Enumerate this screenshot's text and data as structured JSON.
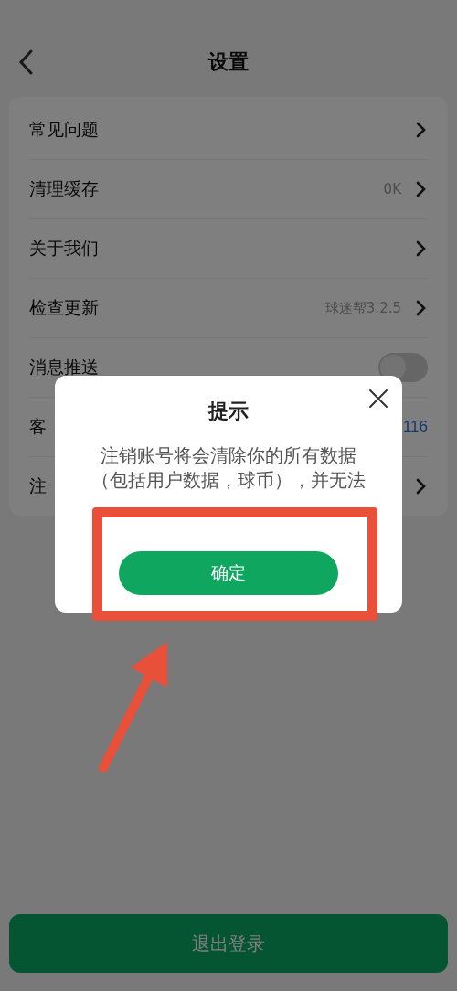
{
  "header": {
    "title": "设置"
  },
  "settings": [
    {
      "kind": "link",
      "label": "常见问题"
    },
    {
      "kind": "link",
      "label": "清理缓存",
      "value": "0K"
    },
    {
      "kind": "link",
      "label": "关于我们"
    },
    {
      "kind": "link",
      "label": "检查更新",
      "value": "球迷帮3.2.5"
    },
    {
      "kind": "toggle",
      "label": "消息推送",
      "on": false
    },
    {
      "kind": "text",
      "label": "客",
      "value": "116"
    },
    {
      "kind": "link",
      "label": "注"
    }
  ],
  "logout_button": "退出登录",
  "dialog": {
    "title": "提示",
    "message": "注销账号将会清除你的所有数据（包括用户数据，球币），并无法",
    "confirm_button": "确定"
  }
}
